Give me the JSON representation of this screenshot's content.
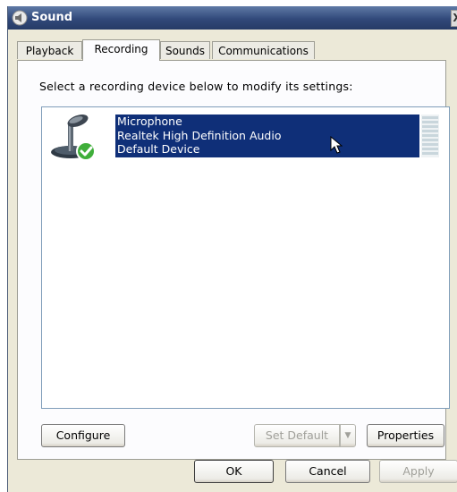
{
  "window": {
    "title": "Sound",
    "close_glyph": "X"
  },
  "tabs": [
    {
      "label": "Playback"
    },
    {
      "label": "Recording"
    },
    {
      "label": "Sounds"
    },
    {
      "label": "Communications"
    }
  ],
  "recording": {
    "instruction": "Select a recording device below to modify its settings:",
    "devices": [
      {
        "name": "Microphone",
        "description": "Realtek High Definition Audio",
        "status": "Default Device",
        "icon": "microphone-icon",
        "status_icon": "check-icon"
      }
    ]
  },
  "buttons": {
    "configure": "Configure",
    "set_default": "Set Default",
    "properties": "Properties",
    "ok": "OK",
    "cancel": "Cancel",
    "apply": "Apply"
  },
  "colors": {
    "selection": "#0f2f78",
    "titlebar": "#31497a",
    "check": "#3fae3a"
  }
}
